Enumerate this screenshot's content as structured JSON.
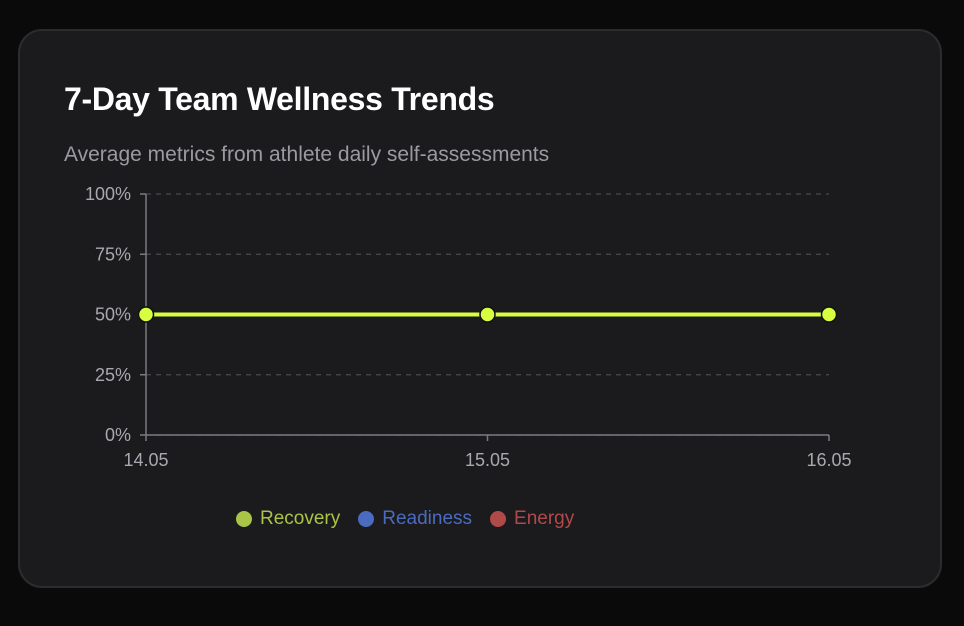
{
  "card": {
    "title": "7-Day Team Wellness Trends",
    "subtitle": "Average metrics from athlete daily self-assessments"
  },
  "colors": {
    "line": "#d8ff3f",
    "grid": "#4a4a4f",
    "axis": "#7a7a80",
    "tick_text": "#a8a8ae"
  },
  "chart_data": {
    "type": "line",
    "title": "7-Day Team Wellness Trends",
    "subtitle": "Average metrics from athlete daily self-assessments",
    "x": [
      "14.05",
      "15.05",
      "16.05"
    ],
    "ylim": [
      0,
      100
    ],
    "yticks": [
      "0%",
      "25%",
      "50%",
      "75%",
      "100%"
    ],
    "ytick_values": [
      0,
      25,
      50,
      75,
      100
    ],
    "grid": true,
    "legend_position": "bottom-left",
    "series": [
      {
        "name": "Recovery",
        "color": "#d8ff3f",
        "legend_color": "#a9c447",
        "values": [
          50,
          50,
          50
        ]
      },
      {
        "name": "Readiness",
        "color": "#4a6bc0",
        "legend_color": "#4a6bc0",
        "values": []
      },
      {
        "name": "Energy",
        "color": "#b04a4a",
        "legend_color": "#b04a4a",
        "values": []
      }
    ]
  }
}
